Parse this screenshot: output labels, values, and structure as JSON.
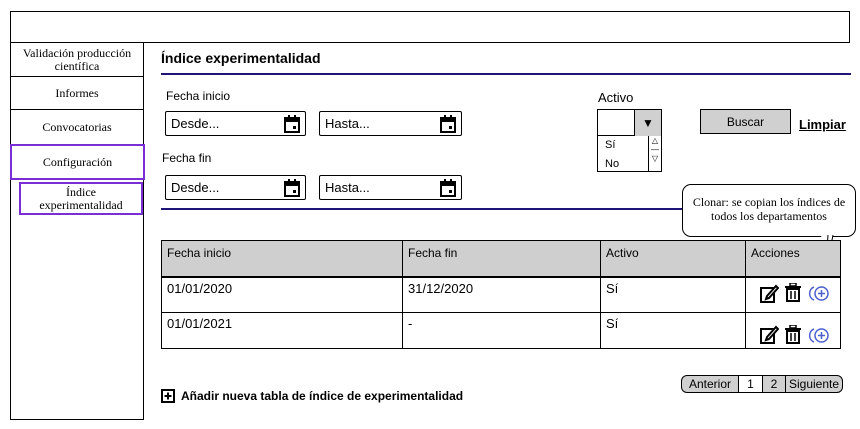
{
  "sidebar": {
    "items": [
      {
        "label": "Validación producción científica"
      },
      {
        "label": "Informes"
      },
      {
        "label": "Convocatorias"
      },
      {
        "label": "Configuración"
      }
    ],
    "sub_item": "Índice experimentalidad"
  },
  "page": {
    "title": "Índice experimentalidad"
  },
  "filters": {
    "fecha_inicio_label": "Fecha inicio",
    "fecha_fin_label": "Fecha fin",
    "desde_placeholder": "Desde...",
    "hasta_placeholder": "Hasta...",
    "activo_label": "Activo",
    "activo_options": [
      "Sí",
      "No"
    ],
    "buscar": "Buscar",
    "limpiar": "Limpiar"
  },
  "table": {
    "headers": [
      "Fecha inicio",
      "Fecha fin",
      "Activo",
      "Acciones"
    ],
    "rows": [
      {
        "inicio": "01/01/2020",
        "fin": "31/12/2020",
        "activo": "Sí"
      },
      {
        "inicio": "01/01/2021",
        "fin": "-",
        "activo": "Sí"
      }
    ]
  },
  "tooltip": "Clonar: se copian los índices de todos los departamentos",
  "add_label": "Añadir nueva tabla de índice de experimentalidad",
  "pagination": {
    "prev": "Anterior",
    "pages": [
      "1",
      "2"
    ],
    "next": "Siguiente"
  },
  "colors": {
    "accent": "#7a2ed6",
    "rule": "#1f1478",
    "clone_icon": "#4a5fd0"
  },
  "icons": {
    "calendar": "calendar-icon",
    "edit": "edit-icon",
    "delete": "trash-icon",
    "clone": "clone-icon",
    "add": "plus-square-icon"
  }
}
